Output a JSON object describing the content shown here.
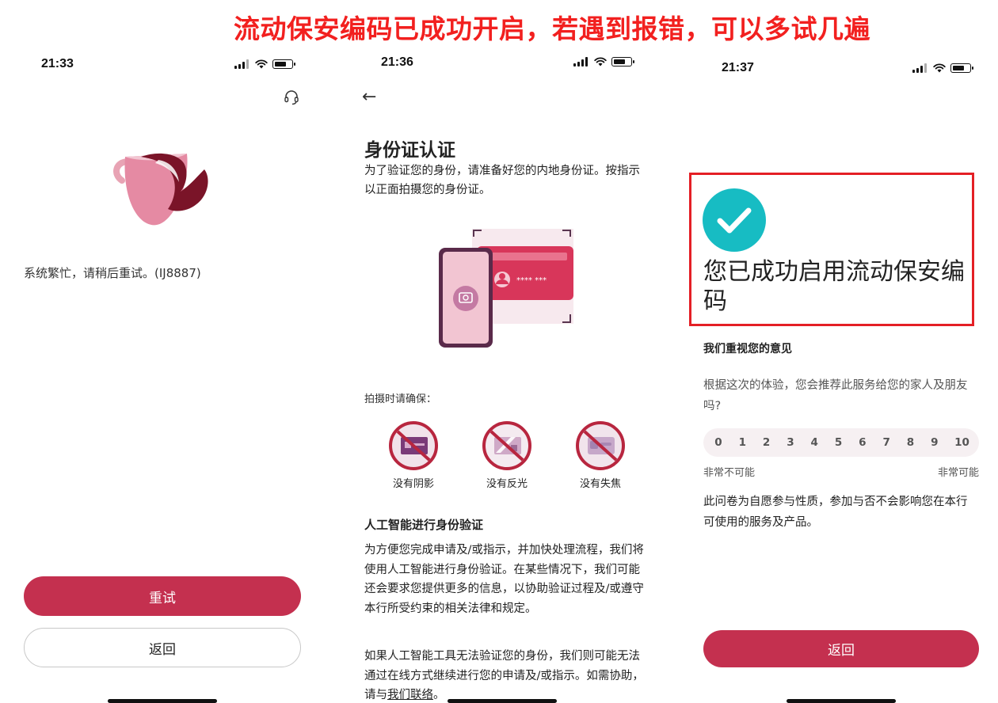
{
  "banner": "流动保安编码已成功开启，若遇到报错，可以多试几遍",
  "screen1": {
    "time": "21:33",
    "error_message": "系统繁忙，请稍后重试。(IJ8887)",
    "retry_label": "重试",
    "back_label": "返回"
  },
  "screen2": {
    "time": "21:36",
    "title": "身份证认证",
    "description": "为了验证您的身份，请准备好您的内地身份证。按指示以正面拍摄您的身份证。",
    "card_number_mask": "**** ***",
    "ensure_label": "拍摄时请确保：",
    "tips": [
      "没有阴影",
      "没有反光",
      "没有失焦"
    ],
    "ai_title": "人工智能进行身份验证",
    "ai_paragraph1": "为方便您完成申请及/或指示，并加快处理流程，我们将使用人工智能进行身份验证。在某些情况下，我们可能还会要求您提供更多的信息，以协助验证过程及/或遵守本行所受约束的相关法律和规定。",
    "ai_paragraph2_prefix": "如果人工智能工具无法验证您的身份，我们则可能无法通过在线方式继续进行您的申请及/或指示。如需协助，请与",
    "ai_paragraph2_link": "我们联络",
    "ai_paragraph2_suffix": "。"
  },
  "screen3": {
    "time": "21:37",
    "success_title": "您已成功启用流动保安编码",
    "feedback_title": "我们重视您的意见",
    "feedback_question": "根据这次的体验，您会推荐此服务给您的家人及朋友吗?",
    "nps_scale": [
      "0",
      "1",
      "2",
      "3",
      "4",
      "5",
      "6",
      "7",
      "8",
      "9",
      "10"
    ],
    "nps_low_label": "非常不可能",
    "nps_high_label": "非常可能",
    "voluntary_note": "此问卷为自愿参与性质，参加与否不会影响您在本行可使用的服务及产品。",
    "back_label": "返回"
  },
  "colors": {
    "brand": "#c4304f",
    "banner_red": "#f2201f",
    "success_teal": "#17bcc3",
    "highlight_box": "#e41f25"
  },
  "icons": [
    "headset-icon",
    "teacup-icon",
    "back-arrow-icon",
    "camera-icon",
    "check-circle-icon",
    "signal-icon",
    "wifi-icon",
    "battery-icon"
  ]
}
